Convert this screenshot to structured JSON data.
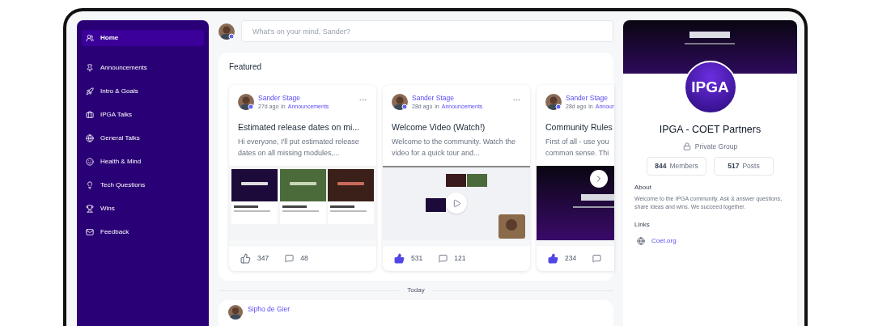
{
  "sidebar": {
    "items": [
      {
        "label": "Home",
        "selected": true
      },
      {
        "label": "Announcements",
        "selected": false
      },
      {
        "label": "Intro & Goals",
        "selected": false
      },
      {
        "label": "IPGA Talks",
        "selected": false
      },
      {
        "label": "General Talks",
        "selected": false
      },
      {
        "label": "Health & Mind",
        "selected": false
      },
      {
        "label": "Tech Questions",
        "selected": false
      },
      {
        "label": "Wins",
        "selected": false
      },
      {
        "label": "Feedback",
        "selected": false
      }
    ]
  },
  "composer": {
    "placeholder": "What's on your mind, Sander?"
  },
  "featured": {
    "title": "Featured",
    "cards": [
      {
        "author": "Sander Stage",
        "time": "27d ago",
        "in": "in",
        "space": "Announcements",
        "title": "Estimated release dates on mi...",
        "excerpt": "Hi everyone, I'll put estimated release dates on all missing modules,...",
        "kind": "thumbnails",
        "liked": false,
        "likes": "347",
        "comments": "48",
        "cut": false
      },
      {
        "author": "Sander Stage",
        "time": "28d ago",
        "in": "in",
        "space": "Announcements",
        "title": "Welcome Video (Watch!)",
        "excerpt": "Welcome to the community. Watch the video for a quick tour and...",
        "kind": "video",
        "liked": true,
        "likes": "531",
        "comments": "121",
        "cut": false
      },
      {
        "author": "Sander Stage",
        "time": "28d ago",
        "in": "in",
        "space": "Announ",
        "title": "Community Rules",
        "excerpt_lines": [
          "First of all - use you",
          "common sense. Thi"
        ],
        "kind": "slides",
        "liked": true,
        "likes": "234",
        "cut": true
      }
    ]
  },
  "divider": "Today",
  "post": {
    "author": "Sipho de Gier"
  },
  "group": {
    "avatar_text": "IPGA",
    "name": "IPGA - COET Partners",
    "privacy": "Private Group",
    "stats": [
      {
        "value": "844",
        "label": "Members"
      },
      {
        "value": "517",
        "label": "Posts"
      }
    ],
    "about_title": "About",
    "about": "Welcome to the IPGA community. Ask & answer questions, share ideas and wins. We succeed together.",
    "links_title": "Links",
    "links": [
      {
        "label": "Coet.org"
      }
    ]
  }
}
